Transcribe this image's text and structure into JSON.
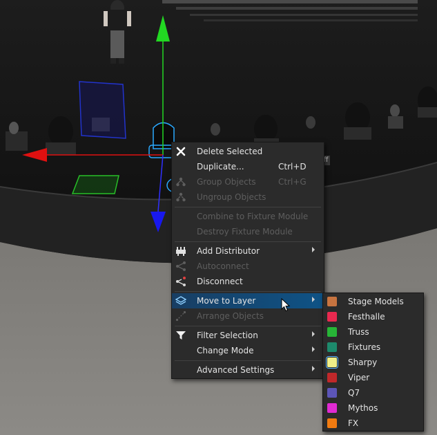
{
  "context_menu": {
    "items": [
      {
        "label": "Delete Selected",
        "icon": "close-icon",
        "enabled": true
      },
      {
        "label": "Duplicate...",
        "shortcut": "Ctrl+D",
        "enabled": true
      },
      {
        "label": "Group Objects",
        "shortcut": "Ctrl+G",
        "icon": "group-icon",
        "enabled": false
      },
      {
        "label": "Ungroup Objects",
        "icon": "ungroup-icon",
        "enabled": false
      },
      {
        "label": "Combine to Fixture Module",
        "enabled": false
      },
      {
        "label": "Destroy Fixture Module",
        "enabled": false
      },
      {
        "label": "Add Distributor",
        "icon": "distributor-icon",
        "enabled": true,
        "submenu": true
      },
      {
        "label": "Autoconnect",
        "icon": "autoconnect-icon",
        "enabled": false
      },
      {
        "label": "Disconnect",
        "icon": "disconnect-icon",
        "enabled": true
      },
      {
        "label": "Move to Layer",
        "icon": "layers-icon",
        "enabled": true,
        "submenu": true,
        "highlighted": true
      },
      {
        "label": "Arrange Objects",
        "icon": "arrange-icon",
        "enabled": false
      },
      {
        "label": "Filter Selection",
        "icon": "filter-icon",
        "enabled": true,
        "submenu": true
      },
      {
        "label": "Change Mode",
        "enabled": true,
        "submenu": true
      },
      {
        "label": "Advanced Settings",
        "enabled": true,
        "submenu": true
      }
    ]
  },
  "layer_submenu": {
    "items": [
      {
        "label": "Stage Models",
        "color": "#c77440"
      },
      {
        "label": "Festhalle",
        "color": "#e8294f"
      },
      {
        "label": "Truss",
        "color": "#27b537"
      },
      {
        "label": "Fixtures",
        "color": "#1d8a6c"
      },
      {
        "label": "Sharpy",
        "color": "#eeee88",
        "hovered": true
      },
      {
        "label": "Viper",
        "color": "#c0282a"
      },
      {
        "label": "Q7",
        "color": "#5c55b8"
      },
      {
        "label": "Mythos",
        "color": "#e02ad2"
      },
      {
        "label": "FX",
        "color": "#f07a10"
      }
    ]
  },
  "stage_label": "ff"
}
